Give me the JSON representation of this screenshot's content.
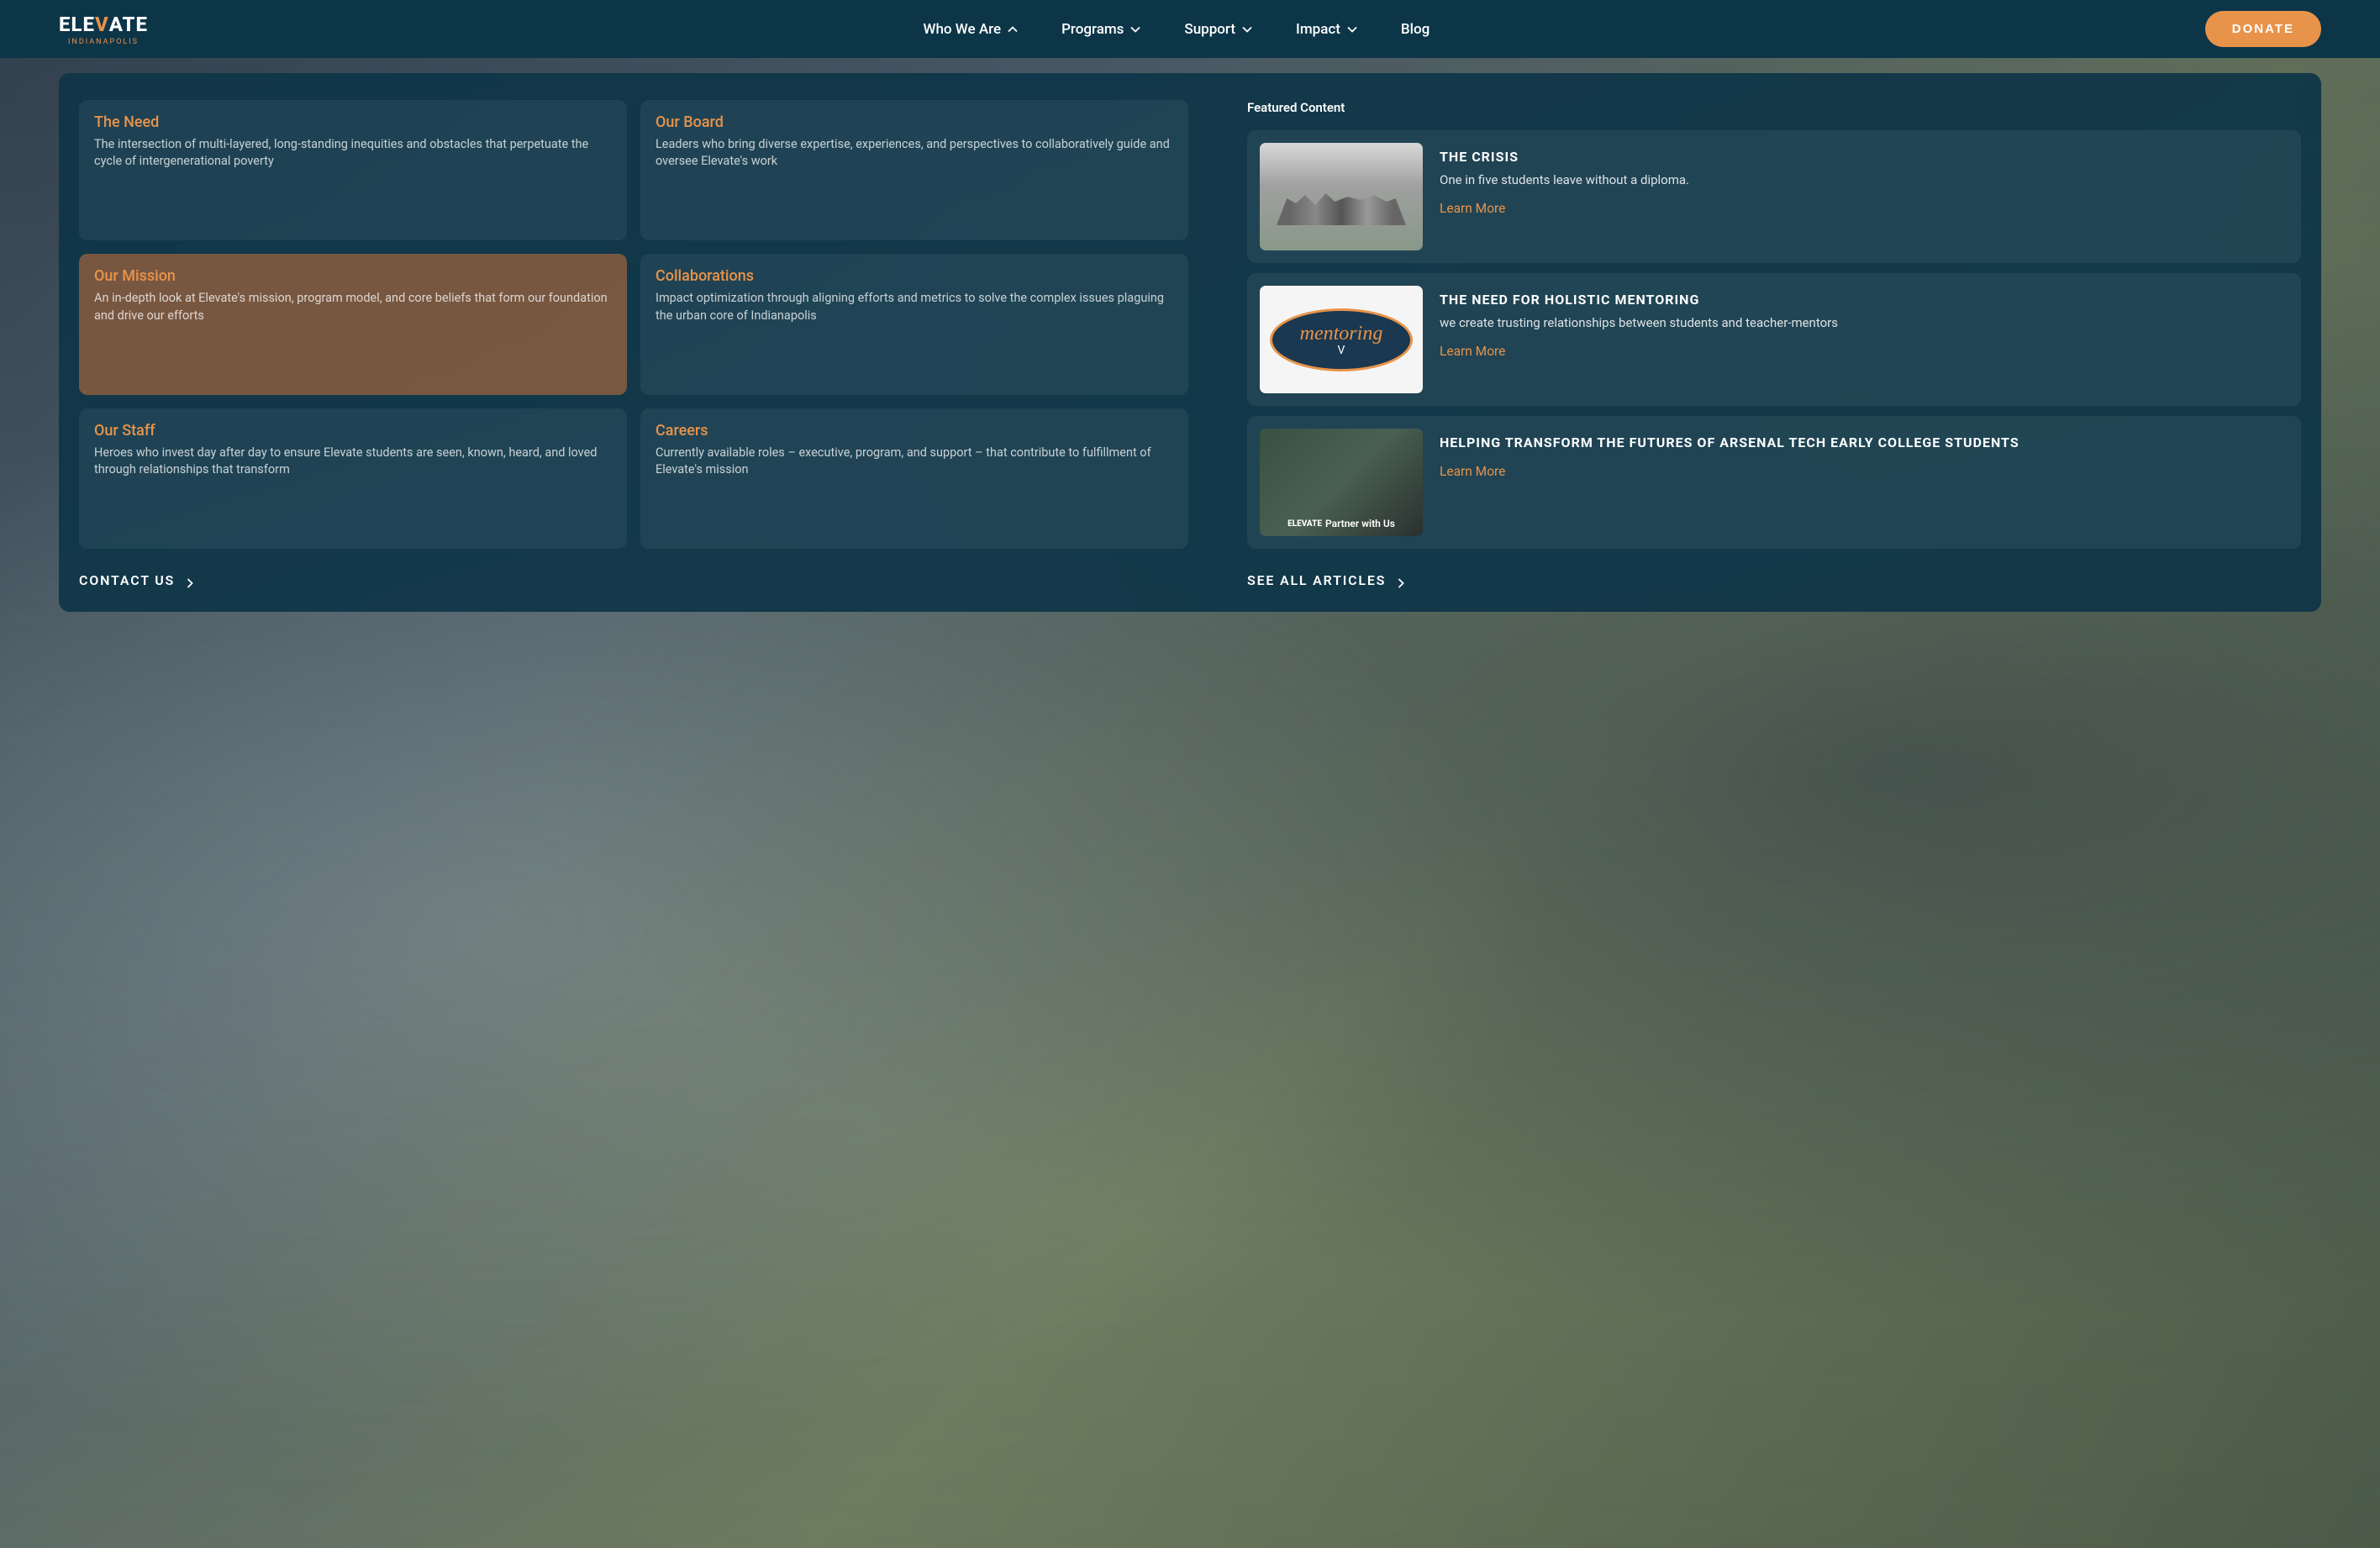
{
  "logo": {
    "part1": "ELE",
    "part2": "V",
    "part3": "ATE",
    "sub": "INDIANAPOLIS"
  },
  "nav": {
    "links": [
      {
        "label": "Who We Are",
        "chevron": "up"
      },
      {
        "label": "Programs",
        "chevron": "down"
      },
      {
        "label": "Support",
        "chevron": "down"
      },
      {
        "label": "Impact",
        "chevron": "down"
      },
      {
        "label": "Blog",
        "chevron": "none"
      }
    ],
    "donate": "DONATE"
  },
  "menu": {
    "items": [
      {
        "title": "The Need",
        "desc": "The intersection of multi-layered, long-standing inequities and obstacles that perpetuate the cycle of intergenerational poverty",
        "active": false
      },
      {
        "title": "Our Board",
        "desc": "Leaders who bring diverse expertise, experiences, and perspectives to collaboratively guide and oversee Elevate's work",
        "active": false
      },
      {
        "title": "Our Mission",
        "desc": "An in-depth look at Elevate's mission, program model, and core beliefs that form our foundation and drive our efforts",
        "active": true
      },
      {
        "title": "Collaborations",
        "desc": "Impact optimization through aligning efforts and metrics to solve the complex issues plaguing the urban core of Indianapolis",
        "active": false
      },
      {
        "title": "Our Staff",
        "desc": "Heroes who invest day after day to ensure Elevate students are seen, known, heard, and loved through relationships that transform",
        "active": false
      },
      {
        "title": "Careers",
        "desc": "Currently available roles – executive, program, and support – that contribute to fulfillment of Elevate's mission",
        "active": false
      }
    ],
    "contactUs": "CONTACT US"
  },
  "featured": {
    "header": "Featured Content",
    "cards": [
      {
        "title": "THE CRISIS",
        "desc": "One in five students leave without a diploma.",
        "learnMore": "Learn More"
      },
      {
        "title": "THE NEED FOR HOLISTIC MENTORING",
        "desc": "we create trusting relationships between students and teacher-mentors",
        "learnMore": "Learn More"
      },
      {
        "title": "HELPING TRANSFORM THE FUTURES OF ARSENAL TECH EARLY COLLEGE STUDENTS",
        "desc": "",
        "learnMore": "Learn More"
      }
    ],
    "mentoring": "mentoring",
    "partnerText": "Partner with Us",
    "partnerLogo": "ELEVATE",
    "seeAll": "SEE ALL ARTICLES"
  }
}
